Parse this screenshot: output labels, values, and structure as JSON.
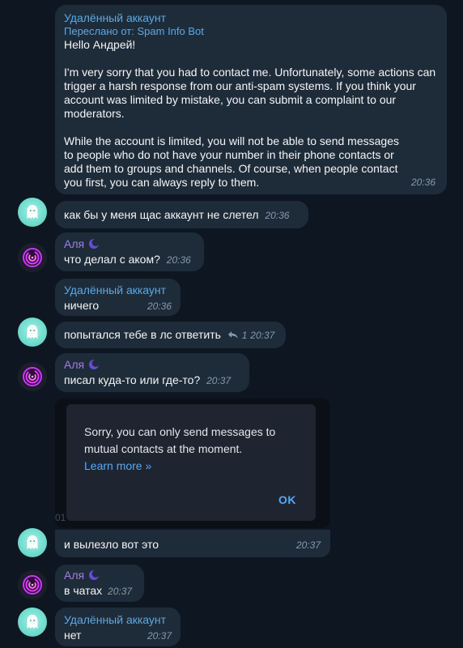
{
  "messages": {
    "m1": {
      "sender": "Удалённый аккаунт",
      "forwarded": "Переслано от: Spam Info Bot",
      "p1": "Hello Андрей!",
      "p2": "I'm very sorry that you had to contact me. Unfortunately, some actions can trigger a harsh response from our anti-spam systems. If you think your account was limited by mistake, you can submit a complaint to our moderators.",
      "p3": "While the account is limited, you will not be able to send messages to people who do not have your number in their phone contacts or add them to groups and channels. Of course, when people contact you first, you can always reply to them.",
      "time": "20:36"
    },
    "m2": {
      "text": "как бы у меня щас аккаунт не слетел",
      "time": "20:36"
    },
    "m3": {
      "sender": "Аля",
      "text": "что делал с аком?",
      "time": "20:36"
    },
    "m4": {
      "sender": "Удалённый аккаунт",
      "text": "ничего",
      "time": "20:36"
    },
    "m5": {
      "text": "попытался тебе в лс ответить",
      "reply_count": "1",
      "time": "20:37"
    },
    "m6": {
      "sender": "Аля",
      "text": "писал куда-то или где-то?",
      "time": "20:37"
    },
    "m7": {
      "dialog_text": "Sorry, you can only send messages to mutual contacts at the moment.",
      "dialog_link": "Learn more »",
      "dialog_ok": "OK",
      "behind_text": "01",
      "text": "и вылезло вот это",
      "time": "20:37"
    },
    "m8": {
      "sender": "Аля",
      "text": "в чатах",
      "time": "20:37"
    },
    "m9": {
      "sender": "Удалённый аккаунт",
      "text": "нет",
      "time": "20:37"
    }
  },
  "icons": {
    "ghost_avatar": "ghost-icon",
    "alya_avatar": "purple-swirl-icon",
    "alya_badge": "crescent-moon-icon",
    "reply": "reply-arrow-icon"
  },
  "colors": {
    "background": "#0e1621",
    "bubble": "#1e2c3a",
    "deleted_name": "#5fa8e0",
    "alya_name": "#a57be8",
    "link": "#5aa7f2",
    "ghost_avatar": "#6fdccd"
  }
}
